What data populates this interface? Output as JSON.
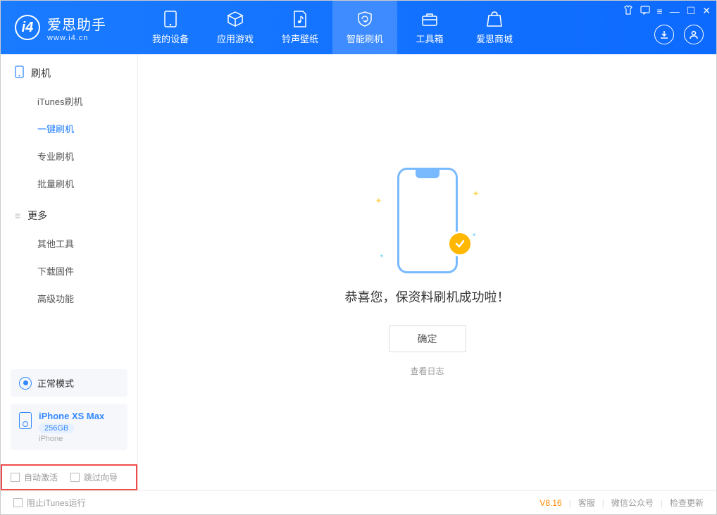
{
  "header": {
    "logo_title": "爱思助手",
    "logo_subtitle": "www.i4.cn",
    "nav": [
      {
        "label": "我的设备"
      },
      {
        "label": "应用游戏"
      },
      {
        "label": "铃声壁纸"
      },
      {
        "label": "智能刷机"
      },
      {
        "label": "工具箱"
      },
      {
        "label": "爱思商城"
      }
    ]
  },
  "sidebar": {
    "section_flash": "刷机",
    "flash_items": [
      {
        "label": "iTunes刷机"
      },
      {
        "label": "一键刷机",
        "active": true
      },
      {
        "label": "专业刷机"
      },
      {
        "label": "批量刷机"
      }
    ],
    "section_more": "更多",
    "more_items": [
      {
        "label": "其他工具"
      },
      {
        "label": "下载固件"
      },
      {
        "label": "高级功能"
      }
    ],
    "mode_label": "正常模式",
    "device": {
      "name": "iPhone XS Max",
      "storage": "256GB",
      "type": "iPhone"
    },
    "auto_activate": "自动激活",
    "skip_guide": "跳过向导"
  },
  "main": {
    "success_title": "恭喜您，保资料刷机成功啦！",
    "ok_button": "确定",
    "view_log": "查看日志"
  },
  "footer": {
    "block_itunes": "阻止iTunes运行",
    "version": "V8.16",
    "support": "客服",
    "wechat": "微信公众号",
    "check_update": "检查更新"
  }
}
